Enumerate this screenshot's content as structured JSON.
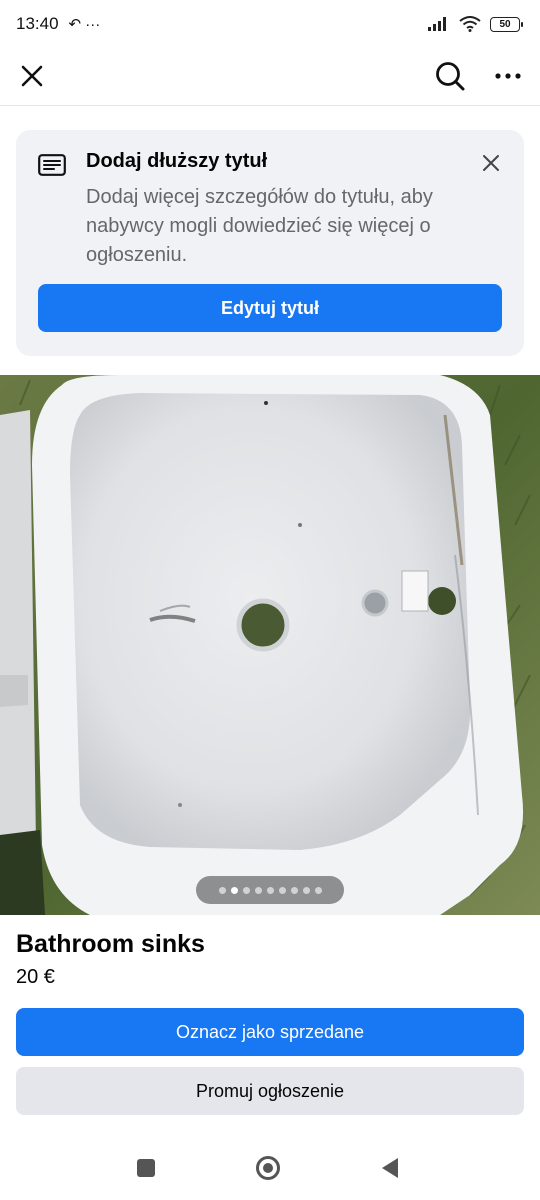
{
  "status_bar": {
    "time": "13:40",
    "extra_icons": "↶ ···",
    "battery": "50"
  },
  "top_bar": {
    "close_icon": "close-icon",
    "search_icon": "search-icon",
    "more_icon": "more-icon"
  },
  "tip_card": {
    "title": "Dodaj dłuższy tytuł",
    "text": "Dodaj więcej szczegółów do tytułu, aby nabywcy mogli dowiedzieć się więcej o ogłoszeniu.",
    "button": "Edytuj tytuł"
  },
  "gallery": {
    "image_count": 9,
    "active_index": 1
  },
  "listing": {
    "title": "Bathroom sinks",
    "price": "20 €",
    "mark_sold_button": "Oznacz jako sprzedane",
    "promote_button": "Promuj ogłoszenie"
  },
  "colors": {
    "accent": "#1877f2",
    "secondary_button": "#e4e6eb",
    "card_bg": "#f0f2f5",
    "muted_text": "#65676b"
  }
}
